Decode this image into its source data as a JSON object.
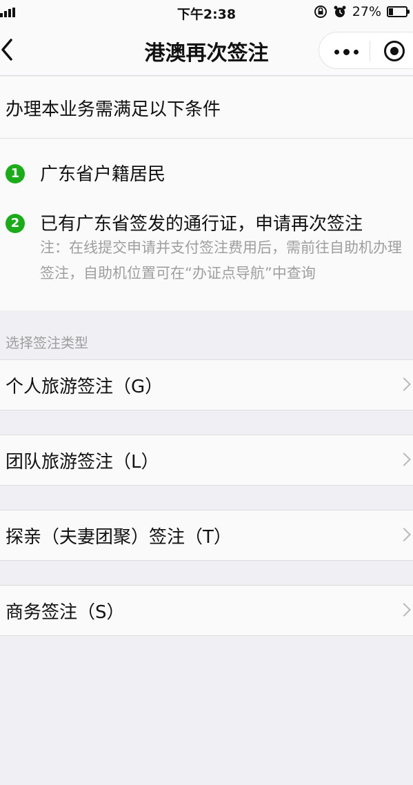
{
  "status_bar": {
    "time": "下午2:38",
    "battery": "27%",
    "battery_level": 0.27
  },
  "nav": {
    "title": "港澳再次签注"
  },
  "conditions": {
    "heading": "办理本业务需满足以下条件",
    "items": [
      {
        "number": "1",
        "text": "广东省户籍居民"
      },
      {
        "number": "2",
        "text": "已有广东省签发的通行证，申请再次签注",
        "note": "注：在线提交申请并支付签注费用后，需前往自助机办理签注，自助机位置可在“办证点导航”中查询"
      }
    ]
  },
  "section": {
    "label": "选择签注类型"
  },
  "types": [
    {
      "label": "个人旅游签注（G）"
    },
    {
      "label": "团队旅游签注（L）"
    },
    {
      "label": "探亲（夫妻团聚）签注（T）"
    },
    {
      "label": "商务签注（S）"
    }
  ],
  "colors": {
    "accent_green": "#1aad19",
    "background": "#efeff4",
    "secondary_text": "#9e9e9e"
  }
}
